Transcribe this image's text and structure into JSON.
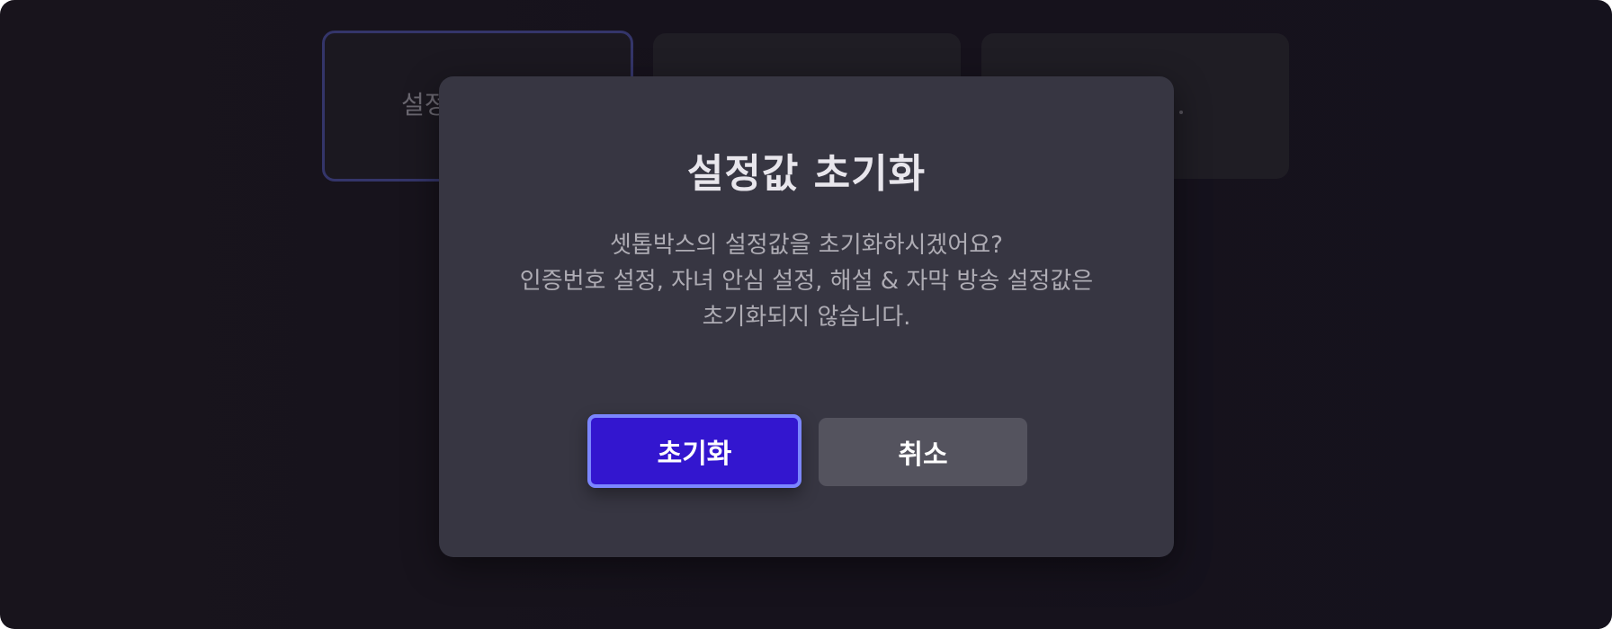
{
  "background": {
    "cards": [
      {
        "label": "설정"
      },
      {
        "label": ""
      },
      {
        "label": ""
      }
    ]
  },
  "dialog": {
    "title": "설정값 초기화",
    "message_lines": [
      "셋톱박스의 설정값을 초기화하시겠어요?",
      "인증번호 설정, 자녀 안심 설정, 해설 & 자막 방송 설정값은",
      "초기화되지 않습니다."
    ],
    "confirm_label": "초기화",
    "cancel_label": "취소"
  },
  "colors": {
    "screen_bg": "#16121c",
    "dialog_bg": "#373642",
    "confirm_bg": "#3316cf",
    "confirm_focus_border": "#7b86ff",
    "cancel_bg": "#54535e",
    "title_text": "#e8e6ec",
    "message_text": "#aeacb4"
  }
}
